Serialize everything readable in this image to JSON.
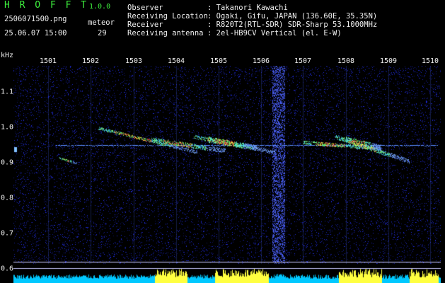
{
  "header": {
    "app_title": "H R O F F T",
    "app_version": "1.0.0",
    "file_name": "2506071500.png",
    "meteor_label": "meteor",
    "date_time": "25.06.07 15:00",
    "meteor_count": "29"
  },
  "info": [
    {
      "label": "Observer",
      "value": ": Takanori Kawachi"
    },
    {
      "label": "Receiving Location",
      "value": ": Ogaki, Gifu, JAPAN (136.60E, 35.35N)"
    },
    {
      "label": "Receiver",
      "value": ": R820T2(RTL-SDR) SDR-Sharp 53.1000MHz"
    },
    {
      "label": "Receiving antenna",
      "value": ": 2el-HB9CV Vertical (el. E-W)"
    }
  ],
  "axes": {
    "y_unit": "kHz",
    "x_ticks": [
      "1501",
      "1502",
      "1503",
      "1504",
      "1505",
      "1506",
      "1507",
      "1508",
      "1509",
      "1510"
    ],
    "y_ticks": [
      "1.1",
      "1.0",
      "0.9",
      "0.8",
      "0.7",
      "0.6"
    ]
  },
  "colors": {
    "title_green": "#3ef23e",
    "background": "#000000",
    "noise_blue": "#1a20c0",
    "carrier": "#5a8cff",
    "echo_yellow": "#ffff40",
    "power_bar_cyan": "#00c8ff"
  }
}
